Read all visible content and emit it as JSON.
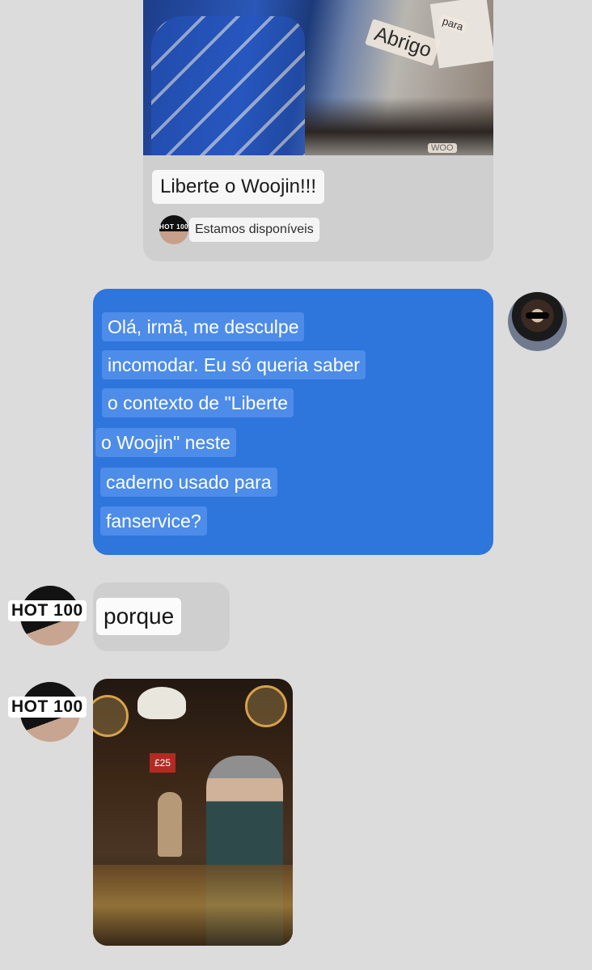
{
  "post": {
    "image_alt": "blue jacket with sketchbook page",
    "sticker_main": "Abrigo",
    "sticker_small": "para",
    "sticker_corner": "WOO",
    "title": "Liberte o Woojin!!!",
    "source_avatar_text": "HOT 100",
    "source_label": "Estamos disponíveis"
  },
  "sent_message": {
    "lines": [
      "Olá, irmã, me desculpe",
      "incomodar. Eu só queria saber",
      "o contexto de \"Liberte",
      "o Woojin\" neste",
      "caderno usado para",
      "fanservice?"
    ],
    "bubble_color": "#2e75dc",
    "highlight_color": "#4d8ce8"
  },
  "received_message": {
    "avatar_badge": "HOT 100",
    "text": "porque"
  },
  "photo_message": {
    "avatar_badge": "HOT 100",
    "sign_text": "£25"
  }
}
